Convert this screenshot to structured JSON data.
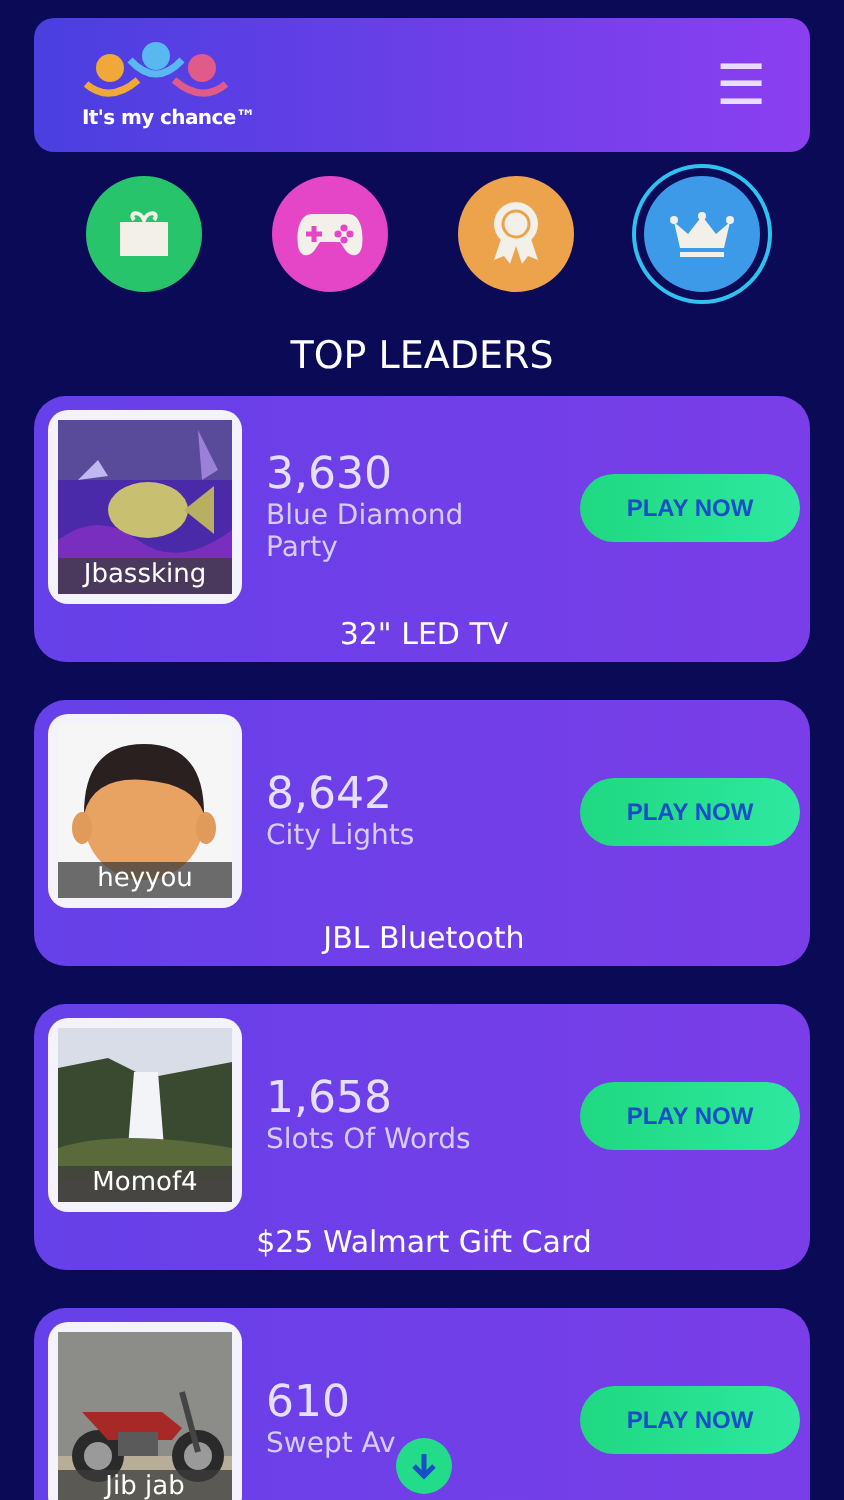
{
  "header": {
    "logo_text": "It's my chance™",
    "menu_icon": "☰"
  },
  "nav": [
    {
      "kind": "gift",
      "color": "#27c46b",
      "selected": false
    },
    {
      "kind": "games",
      "color": "#e546c8",
      "selected": false
    },
    {
      "kind": "award",
      "color": "#eda24c",
      "selected": false
    },
    {
      "kind": "crown",
      "color": "#3d9ae8",
      "selected": true
    }
  ],
  "section_title": "TOP LEADERS",
  "leaders": [
    {
      "player": "Jbassking",
      "score": "3,630",
      "game": "Blue Diamond Party",
      "prize": "32\" LED TV",
      "button": "PLAY NOW"
    },
    {
      "player": "heyyou",
      "score": "8,642",
      "game": "City Lights",
      "prize": "JBL Bluetooth",
      "button": "PLAY NOW"
    },
    {
      "player": "Momof4",
      "score": "1,658",
      "game": "Slots Of Words",
      "prize": "$25 Walmart Gift Card",
      "button": "PLAY NOW"
    },
    {
      "player": "Jib jab",
      "score": "610",
      "game": "Swept Av",
      "button": "PLAY NOW"
    }
  ]
}
